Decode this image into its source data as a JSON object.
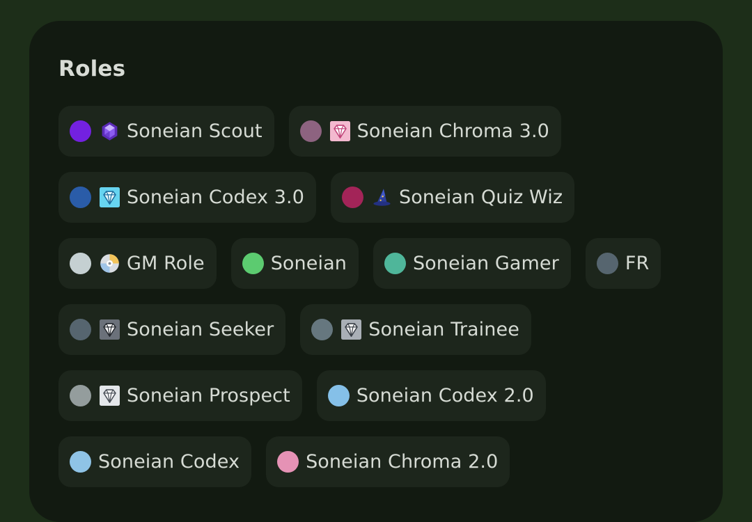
{
  "section": {
    "title": "Roles"
  },
  "roles": [
    {
      "name": "Soneian Scout",
      "color": "#7321e0",
      "icon": "purple-gem-icon"
    },
    {
      "name": "Soneian Chroma 3.0",
      "color": "#8d6380",
      "icon": "pink-diamond-icon"
    },
    {
      "name": "Soneian Codex 3.0",
      "color": "#2a5ca8",
      "icon": "cyan-diamond-icon"
    },
    {
      "name": "Soneian Quiz Wiz",
      "color": "#a32458",
      "icon": "wizard-hat-icon"
    },
    {
      "name": "GM Role",
      "color": "#c5d0d2",
      "icon": "disc-icon"
    },
    {
      "name": "Soneian",
      "color": "#5ccb70",
      "icon": null
    },
    {
      "name": "Soneian Gamer",
      "color": "#4fb69a",
      "icon": null
    },
    {
      "name": "FR",
      "color": "#56656f",
      "icon": null
    },
    {
      "name": "Soneian Seeker",
      "color": "#56656f",
      "icon": "dark-diamond-icon"
    },
    {
      "name": "Soneian Trainee",
      "color": "#66777f",
      "icon": "silver-diamond-icon"
    },
    {
      "name": "Soneian Prospect",
      "color": "#949d9d",
      "icon": "white-diamond-icon"
    },
    {
      "name": "Soneian Codex 2.0",
      "color": "#85c0e8",
      "icon": null
    },
    {
      "name": "Soneian Codex",
      "color": "#8fc3e6",
      "icon": null
    },
    {
      "name": "Soneian Chroma 2.0",
      "color": "#e592b5",
      "icon": null
    }
  ]
}
